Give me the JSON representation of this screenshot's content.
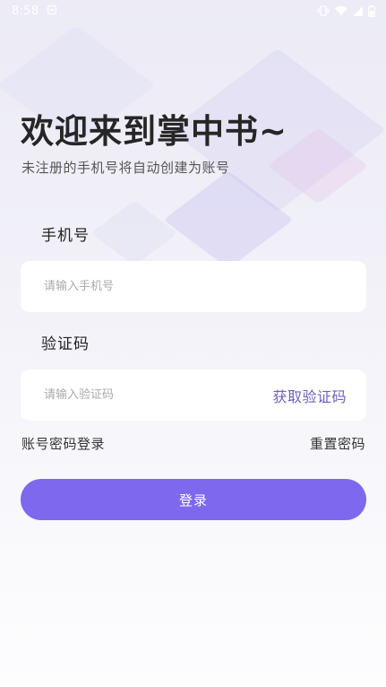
{
  "status_bar": {
    "time": "8:58",
    "icons": [
      "notification-icon",
      "vibrate-icon",
      "wifi-icon",
      "signal-icon",
      "battery-icon"
    ]
  },
  "header": {
    "title": "欢迎来到掌中书~",
    "subtitle": "未注册的手机号将自动创建为账号"
  },
  "phone": {
    "label": "手机号",
    "placeholder": "请输入手机号",
    "value": ""
  },
  "code": {
    "label": "验证码",
    "placeholder": "请输入验证码",
    "value": "",
    "get_code_label": "获取验证码"
  },
  "links": {
    "password_login": "账号密码登录",
    "reset_password": "重置密码"
  },
  "login_button": "登录",
  "colors": {
    "accent": "#7d68ee",
    "link_accent": "#6c5fc7",
    "background_top": "#ecebf6",
    "field_background": "#ffffff"
  }
}
